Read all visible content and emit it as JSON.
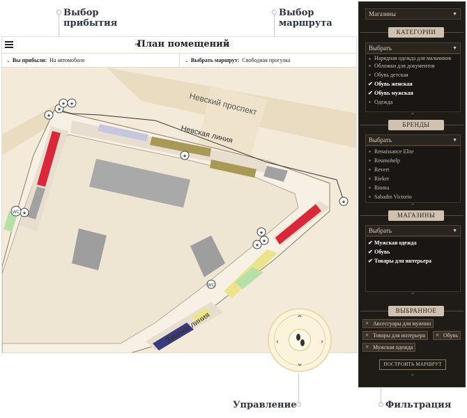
{
  "callouts": {
    "arrival": "Выбор прибытия",
    "route": "Выбор маршрута",
    "control": "Управление",
    "filter": "Фильтрация"
  },
  "map": {
    "title": "План помещений",
    "arrived_label": "Вы прибыли:",
    "arrived_value": "На автомобиле",
    "route_label": "Выбрать маршрут:",
    "route_value": "Свободная прогулка",
    "street_1": "Невский проспект",
    "street_2": "Невская линия",
    "street_3": "Зимняя линия",
    "wc": "WC"
  },
  "icons": {
    "menu": "menu-icon",
    "pad": "footprint-icon"
  },
  "filter": {
    "type_select": "Магазины",
    "categories": {
      "header": "КАТЕГОРИИ",
      "select": "Выбрать",
      "items": [
        {
          "label": "Нарядная одежда для мальчиков",
          "checked": false
        },
        {
          "label": "Обложки для документов",
          "checked": false
        },
        {
          "label": "Обувь детская",
          "checked": false
        },
        {
          "label": "Обувь женская",
          "checked": true
        },
        {
          "label": "Обувь мужская",
          "checked": true
        },
        {
          "label": "Одежда",
          "checked": false
        }
      ]
    },
    "brands": {
      "header": "БРЕНДЫ",
      "select": "Выбрать",
      "items": [
        {
          "label": "Renaissance Elite",
          "checked": false
        },
        {
          "label": "Reumohelp",
          "checked": false
        },
        {
          "label": "Revert",
          "checked": false
        },
        {
          "label": "Rieker",
          "checked": false
        },
        {
          "label": "Rioma",
          "checked": false
        },
        {
          "label": "Sabadin Victorio",
          "checked": false
        }
      ]
    },
    "shops": {
      "header": "МАГАЗИНЫ",
      "select": "Выбрать",
      "items": [
        {
          "label": "Мужская одежда",
          "checked": true
        },
        {
          "label": "Обувь",
          "checked": true
        },
        {
          "label": "Товары для интерьера",
          "checked": true
        }
      ]
    },
    "favorites": {
      "header": "ВЫБРАННОЕ",
      "tags": [
        "Аксессуары для мужчин",
        "Товары для интерьера",
        "Обувь",
        "Мужская одежда"
      ]
    },
    "route_button": "ПОСТРОИТЬ МАРШРУТ"
  },
  "colors": {
    "map_bg": "#f3ead9",
    "panel_bg": "#1f1b17",
    "shop_red": "#d8283a",
    "shop_blue": "#3b3a7a",
    "shop_olive": "#a89a56",
    "shop_green": "#b7e0a8",
    "shop_yellow": "#ece48c"
  }
}
